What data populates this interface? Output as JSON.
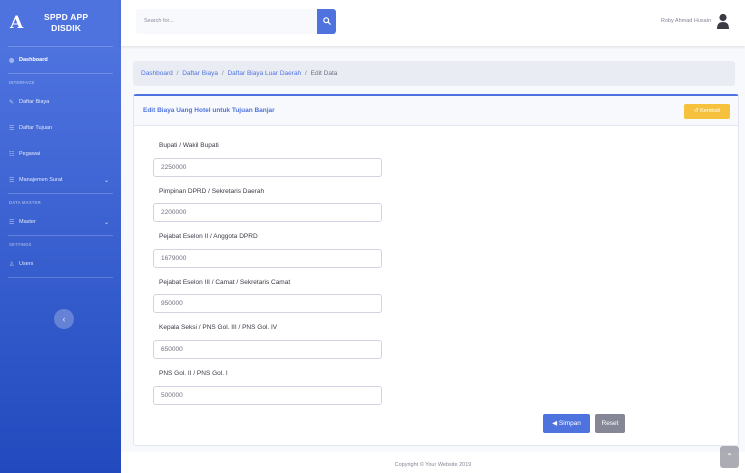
{
  "sidebar": {
    "brand_logo": "A",
    "brand_title": "SPPD APP",
    "brand_subtitle": "DISDIK",
    "items": [
      {
        "label": "Dashboard"
      },
      {
        "label": "Daftar Biaya"
      },
      {
        "label": "Daftar Tujuan"
      },
      {
        "label": "Pegawai"
      },
      {
        "label": "Manajemen Surat"
      },
      {
        "label": "Master"
      },
      {
        "label": "Users"
      }
    ],
    "headings": [
      "INTERFACE",
      "DATA MASTER",
      "SETTINGS"
    ],
    "toggle_glyph": "‹"
  },
  "topbar": {
    "search_placeholder": "Search for...",
    "search_icon": "search-icon",
    "user_name": "Roby Ahmad Husain"
  },
  "breadcrumb": {
    "items": [
      "Dashboard",
      "Daftar Biaya",
      "Daftar Biaya Luar Daerah"
    ],
    "current": "Edit Data",
    "sep": "/"
  },
  "card": {
    "title": "Edit Biaya Uang Hotel untuk Tujuan Banjar",
    "back_label": "Kembali"
  },
  "form": {
    "fields": [
      {
        "label": "Bupati / Wakil Bupati",
        "value": "2250000"
      },
      {
        "label": "Pimpinan DPRD / Sekretaris Daerah",
        "value": "2200000"
      },
      {
        "label": "Pejabat Eselon II / Anggota DPRD",
        "value": "1679000"
      },
      {
        "label": "Pejabat Eselon III / Camat / Sekretaris Camat",
        "value": "950000"
      },
      {
        "label": "Kepala Seksi / PNS Gol. III / PNS Gol. IV",
        "value": "650000"
      },
      {
        "label": "PNS Gol. II / PNS Gol. I",
        "value": "500000"
      }
    ],
    "save_label": "Simpan",
    "reset_label": "Reset"
  },
  "footer": {
    "text": "Copyright © Your Website 2019"
  },
  "colors": {
    "primary": "#4e73df",
    "warning": "#f6c23e",
    "secondary": "#858796"
  }
}
